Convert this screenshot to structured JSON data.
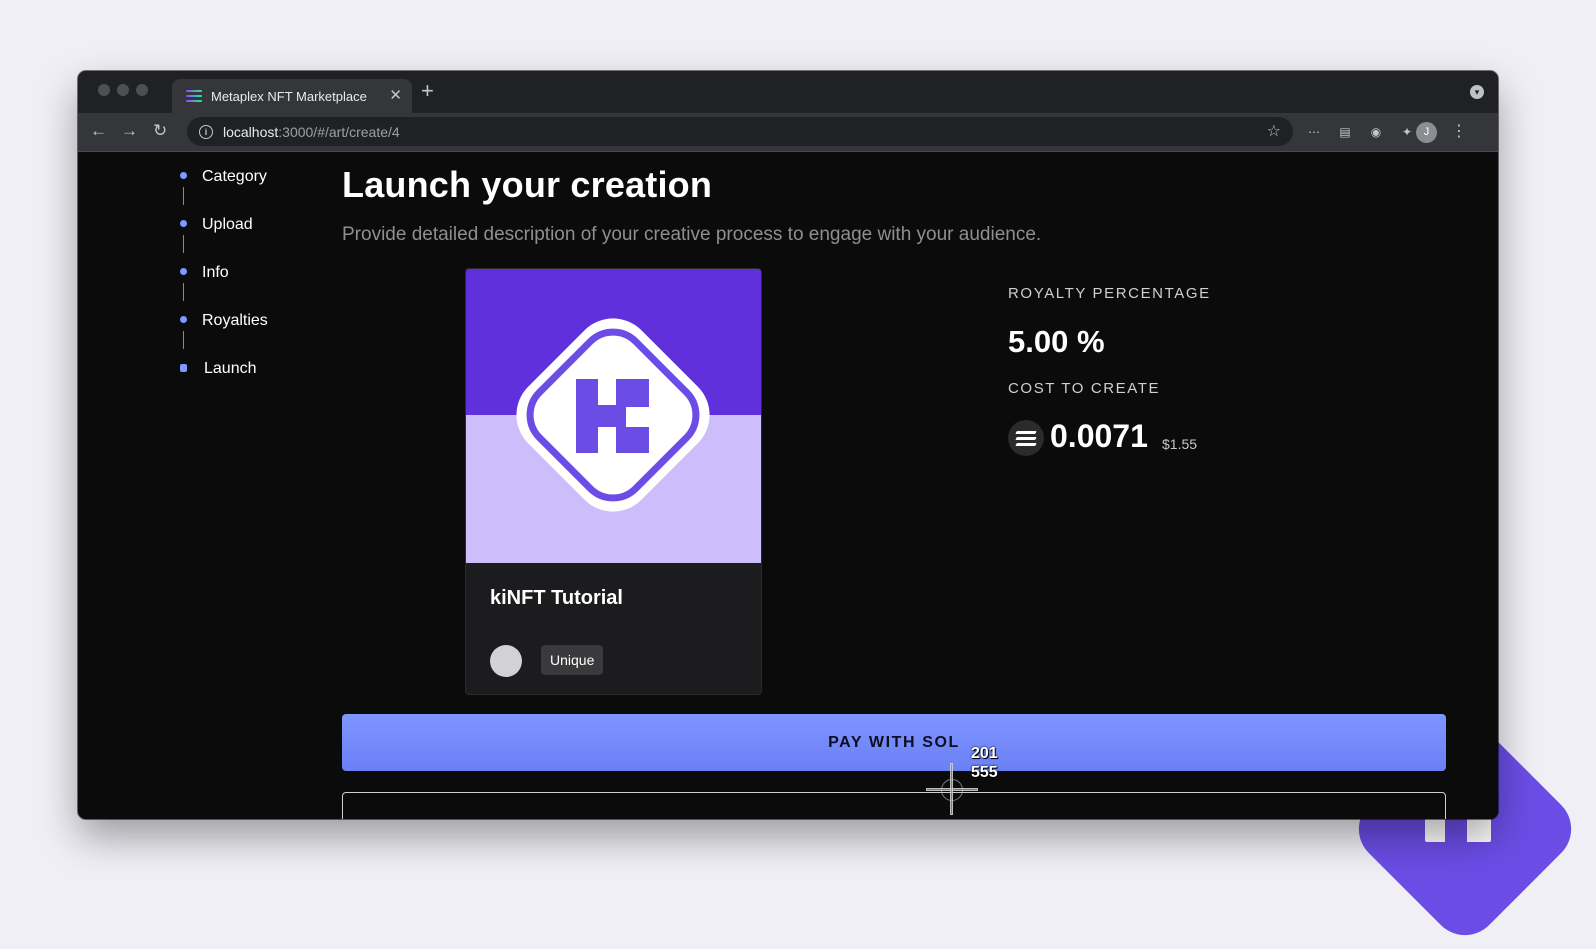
{
  "browser": {
    "tab_title": "Metaplex NFT Marketplace",
    "url_host": "localhost",
    "url_path": ":3000/#/art/create/4",
    "profile_initial": "J"
  },
  "stepper": {
    "items": [
      {
        "label": "Category"
      },
      {
        "label": "Upload"
      },
      {
        "label": "Info"
      },
      {
        "label": "Royalties"
      },
      {
        "label": "Launch"
      }
    ]
  },
  "main": {
    "title": "Launch your creation",
    "subtitle": "Provide detailed description of your creative process to engage with your audience."
  },
  "card": {
    "name": "kiNFT Tutorial",
    "edition": "Unique",
    "art_colors": {
      "top": "#6030dc",
      "bottom": "#cdbdfb",
      "logo": "#6b4de6"
    }
  },
  "royalty": {
    "label": "ROYALTY PERCENTAGE",
    "value": "5.00 %"
  },
  "cost": {
    "label": "COST TO CREATE",
    "sol_value": "0.0071",
    "usd_value": "$1.55",
    "icon": "solana-icon"
  },
  "actions": {
    "pay_label": "PAY WITH SOL"
  },
  "cursor": {
    "x_readout": "201",
    "y_readout": "555"
  },
  "colors": {
    "accent": "#7f95ff",
    "step_dot": "#7c9bff",
    "background": "#0b0b0c"
  }
}
